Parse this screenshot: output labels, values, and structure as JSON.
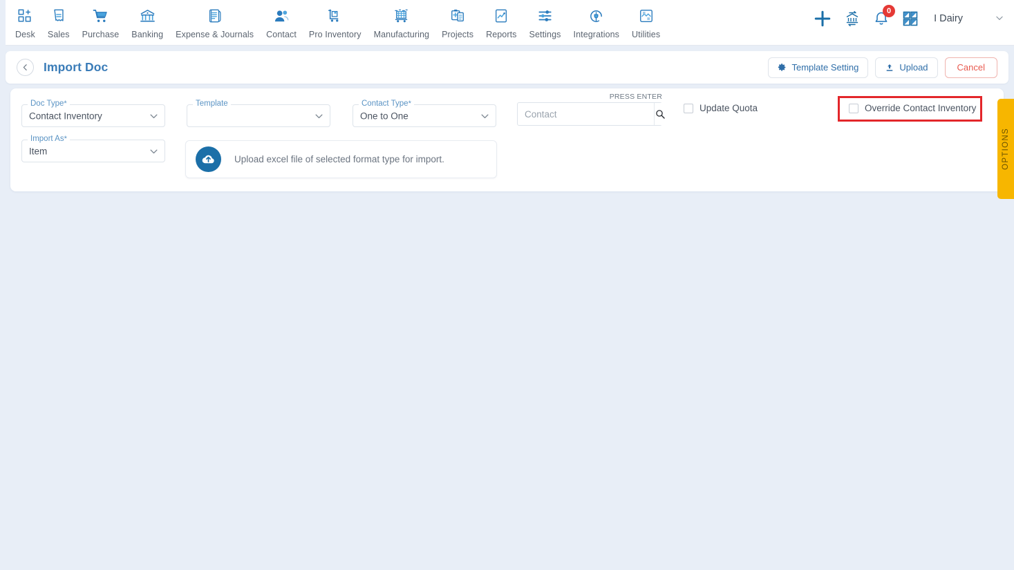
{
  "topnav": {
    "items": [
      {
        "label": "Desk",
        "icon": "dashboard-add-icon"
      },
      {
        "label": "Sales",
        "icon": "receipt-icon"
      },
      {
        "label": "Purchase",
        "icon": "shopping-cart-icon"
      },
      {
        "label": "Banking",
        "icon": "bank-icon"
      },
      {
        "label": "Expense & Journals",
        "icon": "journal-book-icon"
      },
      {
        "label": "Contact",
        "icon": "people-icon"
      },
      {
        "label": "Pro Inventory",
        "icon": "hand-truck-icon"
      },
      {
        "label": "Manufacturing",
        "icon": "factory-icon"
      },
      {
        "label": "Projects",
        "icon": "clipboard-icon"
      },
      {
        "label": "Reports",
        "icon": "report-chart-icon"
      },
      {
        "label": "Settings",
        "icon": "sliders-icon"
      },
      {
        "label": "Integrations",
        "icon": "plug-circle-icon"
      },
      {
        "label": "Utilities",
        "icon": "tools-grid-icon"
      }
    ],
    "right": {
      "add_icon": "plus-icon",
      "transfer_icon": "bank-transfer-icon",
      "notification_icon": "bell-icon",
      "notification_count": "0",
      "apps_icon": "grid-apps-icon",
      "user_name": "I Dairy",
      "user_caret_icon": "chevron-down-icon"
    }
  },
  "header": {
    "back_icon": "chevron-left-icon",
    "title": "Import Doc",
    "actions": {
      "template_setting": {
        "label": "Template Setting",
        "icon": "gear-icon"
      },
      "upload": {
        "label": "Upload",
        "icon": "upload-icon"
      },
      "cancel": {
        "label": "Cancel"
      }
    }
  },
  "form": {
    "doc_type": {
      "label": "Doc Type",
      "required": "*",
      "value": "Contact Inventory"
    },
    "template": {
      "label": "Template",
      "required": "",
      "value": ""
    },
    "contact_type": {
      "label": "Contact Type",
      "required": "*",
      "value": "One to One"
    },
    "import_as": {
      "label": "Import As",
      "required": "*",
      "value": "Item"
    },
    "search": {
      "hint": "PRESS ENTER",
      "placeholder": "Contact",
      "value": "",
      "icon": "search-icon"
    },
    "checkboxes": [
      {
        "label": "Update Quota",
        "checked": false
      },
      {
        "label": "Override Contact Inventory",
        "checked": false
      }
    ],
    "upload_zone": {
      "icon": "cloud-upload-icon",
      "text": "Upload excel file of selected format type for import."
    }
  },
  "options_tab": {
    "label": "OPTIONS"
  },
  "colors": {
    "page_bg": "#e8eef7",
    "brand_blue": "#1b6fa8",
    "title_blue": "#3a7cb8",
    "label_blue": "#5a93c4",
    "cancel_red": "#e8594e",
    "badge_red": "#e53935",
    "annotation_red": "#e3262a",
    "options_yellow": "#f7b600"
  }
}
